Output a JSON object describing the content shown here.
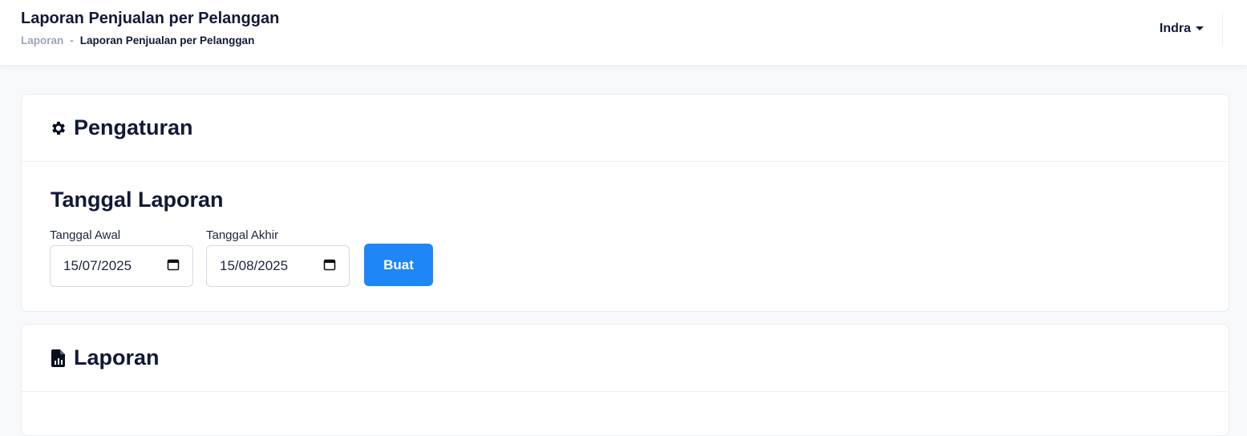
{
  "header": {
    "title": "Laporan Penjualan per Pelanggan",
    "breadcrumb": {
      "parent": "Laporan",
      "separator": "-",
      "current": "Laporan Penjualan per Pelanggan"
    },
    "user": {
      "name": "Indra"
    }
  },
  "settings_card": {
    "title": "Pengaturan",
    "icon": "gear-icon",
    "section_title": "Tanggal Laporan",
    "start_date": {
      "label": "Tanggal Awal",
      "value": "15/07/2025"
    },
    "end_date": {
      "label": "Tanggal Akhir",
      "value": "15/08/2025"
    },
    "submit_label": "Buat"
  },
  "report_card": {
    "title": "Laporan",
    "icon": "file-chart-icon"
  },
  "colors": {
    "primary": "#1f86f7",
    "text": "#111936",
    "muted": "#9aa3b8"
  }
}
